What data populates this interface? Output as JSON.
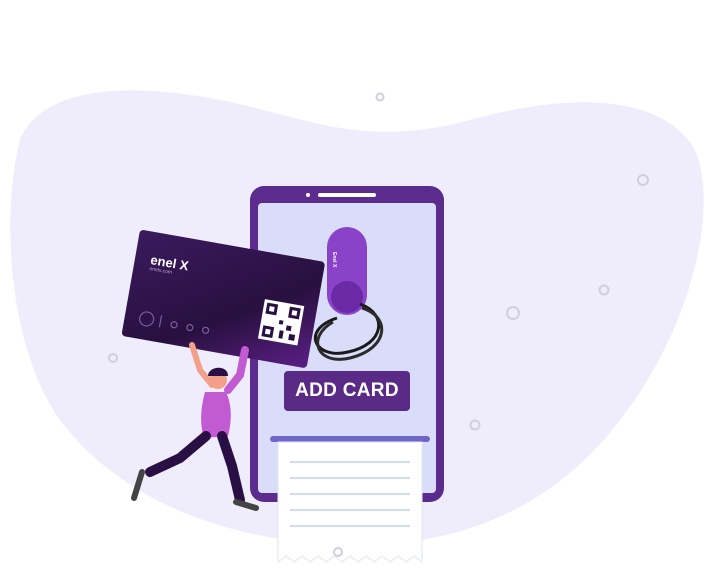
{
  "card": {
    "brand": "enel X",
    "subtitle": "enelx.com"
  },
  "charger": {
    "label": "Enel X"
  },
  "button": {
    "label": "ADD CARD"
  },
  "colors": {
    "blob": "#efecfb",
    "phone_frame": "#5c2b8e",
    "phone_screen": "#d9ddf9",
    "accent_purple": "#8a42c9",
    "button": "#5a2a87",
    "card_dark": "#2a0f45"
  },
  "icons": [
    "qr-code-icon",
    "contactless-icon",
    "charger-plug-icon"
  ]
}
